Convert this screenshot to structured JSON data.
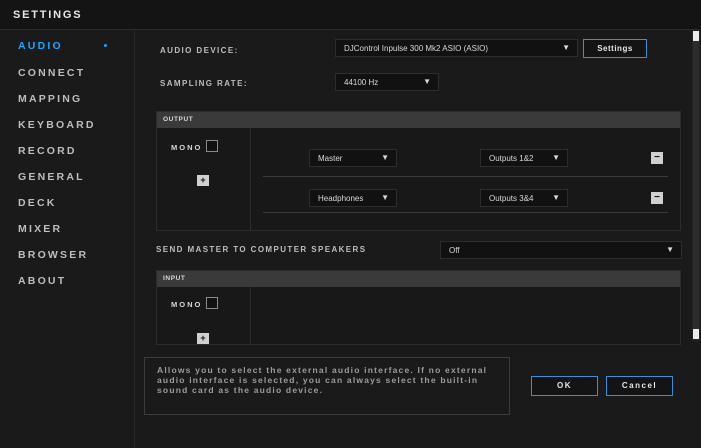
{
  "header": {
    "title": "SETTINGS"
  },
  "sidebar": {
    "items": [
      {
        "label": "AUDIO"
      },
      {
        "label": "CONNECT"
      },
      {
        "label": "MAPPING"
      },
      {
        "label": "KEYBOARD"
      },
      {
        "label": "RECORD"
      },
      {
        "label": "GENERAL"
      },
      {
        "label": "DECK"
      },
      {
        "label": "MIXER"
      },
      {
        "label": "BROWSER"
      },
      {
        "label": "ABOUT"
      }
    ],
    "active_index": 0
  },
  "audio": {
    "device_label": "AUDIO DEVICE:",
    "device_value": "DJControl Inpulse 300 Mk2 ASIO (ASIO)",
    "settings_button": "Settings",
    "sampling_label": "SAMPLING RATE:",
    "sampling_value": "44100 Hz"
  },
  "output": {
    "title": "OUTPUT",
    "mono_label": "MONO",
    "plus": "+",
    "rows": [
      {
        "source": "Master",
        "outputs": "Outputs 1&2",
        "remove": "−"
      },
      {
        "source": "Headphones",
        "outputs": "Outputs 3&4",
        "remove": "−"
      }
    ]
  },
  "send_master": {
    "label": "SEND MASTER TO COMPUTER SPEAKERS",
    "value": "Off"
  },
  "input": {
    "title": "INPUT",
    "mono_label": "MONO",
    "plus": "+"
  },
  "footer": {
    "info": "Allows you to select the external audio interface. If no external audio interface is selected, you can always select the built-in sound card as the audio device.",
    "ok_label": "OK",
    "cancel_label": "Cancel"
  },
  "icons": {
    "dropdown": "▼",
    "active_indicator": "•"
  },
  "colors": {
    "accent": "#1aa3ff",
    "button_border": "#3b8fd4",
    "background": "#1a1a1a"
  }
}
